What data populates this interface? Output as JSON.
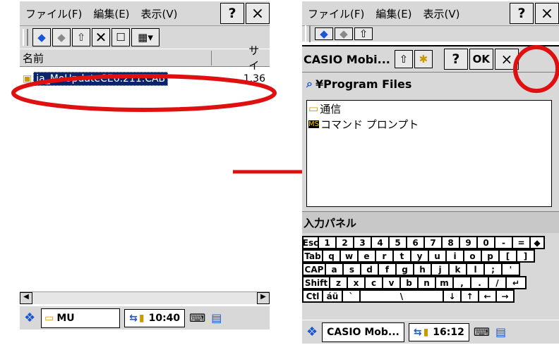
{
  "left": {
    "menu": [
      "ファイル(F)",
      "編集(E)",
      "表示(V)"
    ],
    "menu_keys": [
      "F",
      "E",
      "V"
    ],
    "help_label": "?",
    "close_label": "×",
    "col_name": "名前",
    "col_size": "サイ",
    "file_name": "ja_MoUpdateCE6.211.CAB",
    "file_size": "1.36",
    "task_label": "MU",
    "clock": "10:40"
  },
  "right": {
    "menu": [
      "ファイル(F)",
      "編集(E)",
      "表示(V)"
    ],
    "help_label": "?",
    "close_label": "×",
    "dialog_title": "CASIO Mobi...",
    "dialog_help": "?",
    "dialog_ok": "OK",
    "dialog_close": "×",
    "path": "¥Program Files",
    "items": [
      "通信",
      "コマンド プロンプト"
    ],
    "sip_title": "入力パネル",
    "keyboard": [
      [
        "Esc",
        "1",
        "2",
        "3",
        "4",
        "5",
        "6",
        "7",
        "8",
        "9",
        "0",
        "-",
        "=",
        "◆"
      ],
      [
        "Tab",
        "q",
        "w",
        "e",
        "r",
        "t",
        "y",
        "u",
        "i",
        "o",
        "p",
        "[",
        "]"
      ],
      [
        "CAP",
        "a",
        "s",
        "d",
        "f",
        "g",
        "h",
        "j",
        "k",
        "l",
        ";",
        "'"
      ],
      [
        "Shift",
        "z",
        "x",
        "c",
        "v",
        "b",
        "n",
        "m",
        ",",
        ".",
        "/",
        "↵"
      ],
      [
        "Ctl",
        "áü",
        "`",
        "\\",
        "↓",
        "↑",
        "←",
        "→"
      ]
    ],
    "task_label": "CASIO Mob...",
    "clock": "16:12"
  },
  "colors": {
    "highlight": "#0a246a",
    "annotation": "#e01010",
    "chrome": "#d8d8d8"
  }
}
